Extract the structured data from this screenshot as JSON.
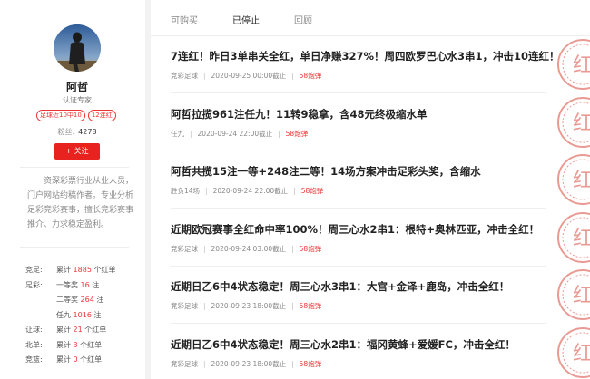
{
  "profile": {
    "name": "阿哲",
    "role": "认证专家",
    "tags": [
      "足球近10中10",
      "12连红"
    ],
    "fans_label": "粉丝:",
    "fans_count": "4278",
    "follow_label": "+ 关注",
    "description": "资深彩票行业从业人员，门户网站约稿作者。专业分析足彩竞彩赛事，擅长竞彩赛事推介、力求稳定盈利。"
  },
  "stats": [
    {
      "label": "竞足:",
      "prefix": "累计 ",
      "value": "1885",
      "suffix": " 个红单"
    },
    {
      "label": "足彩:",
      "prefix": "一等奖 ",
      "value": "16",
      "suffix": " 注"
    },
    {
      "label": "",
      "prefix": "二等奖 ",
      "value": "264",
      "suffix": " 注"
    },
    {
      "label": "",
      "prefix": "任九 ",
      "value": "1016",
      "suffix": " 注"
    },
    {
      "label": "让球:",
      "prefix": "累计 ",
      "value": "21",
      "suffix": " 个红单"
    },
    {
      "label": "北单:",
      "prefix": "累计 ",
      "value": "3",
      "suffix": " 个红单"
    },
    {
      "label": "竞篮:",
      "prefix": "累计 ",
      "value": "0",
      "suffix": " 个红单"
    }
  ],
  "tabs": [
    "可购买",
    "已停止",
    "回顾"
  ],
  "articles": [
    {
      "title": "7连红！昨日3单串关全红，单日净赚327%！周四欧罗巴心水3串1，冲击10连红！",
      "category": "竞彩足球",
      "time": "2020-09-25 00:00截止",
      "count": "58炮弹"
    },
    {
      "title": "阿哲拉揽961注任九！11转9稳拿，含48元终极缩水单",
      "category": "任九",
      "time": "2020-09-24 22:00截止",
      "count": "58炮弹"
    },
    {
      "title": "阿哲共揽15注一等+248注二等！14场方案冲击足彩头奖，含缩水",
      "category": "胜负14场",
      "time": "2020-09-24 22:00截止",
      "count": "58炮弹"
    },
    {
      "title": "近期欧冠赛事全红命中率100%！周三心水2串1：根特+奥林匹亚，冲击全红！",
      "category": "竞彩足球",
      "time": "2020-09-24 03:00截止",
      "count": "58炮弹"
    },
    {
      "title": "近期日乙6中4状态稳定！周三心水3串1：大宫+金泽+鹿岛，冲击全红！",
      "category": "竞彩足球",
      "time": "2020-09-23 18:00截止",
      "count": "58炮弹"
    },
    {
      "title": "近期日乙6中4状态稳定！周三心水2串1：福冈黄蜂+爱媛FC，冲击全红！",
      "category": "竞彩足球",
      "time": "2020-09-23 18:00截止",
      "count": "58炮弹"
    }
  ],
  "stamp_text": "红",
  "colors": {
    "accent": "#e8231f",
    "text": "#222222",
    "muted": "#888888"
  }
}
